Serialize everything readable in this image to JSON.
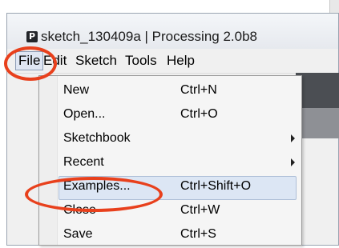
{
  "window": {
    "title": "sketch_130409a | Processing 2.0b8",
    "app_icon_letter": "P"
  },
  "menubar": {
    "items": [
      "File",
      "Edit",
      "Sketch",
      "Tools",
      "Help"
    ]
  },
  "file_menu": {
    "items": [
      {
        "label": "New",
        "shortcut": "Ctrl+N",
        "submenu": false
      },
      {
        "label": "Open...",
        "shortcut": "Ctrl+O",
        "submenu": false
      },
      {
        "label": "Sketchbook",
        "shortcut": "",
        "submenu": true
      },
      {
        "label": "Recent",
        "shortcut": "",
        "submenu": true
      },
      {
        "label": "Examples...",
        "shortcut": "Ctrl+Shift+O",
        "submenu": false,
        "selected": true
      },
      {
        "label": "Close",
        "shortcut": "Ctrl+W",
        "submenu": false
      },
      {
        "label": "Save",
        "shortcut": "Ctrl+S",
        "submenu": false
      }
    ]
  },
  "annotations": {
    "ring_color": "#e8401c",
    "circled": [
      "File",
      "Examples..."
    ]
  }
}
